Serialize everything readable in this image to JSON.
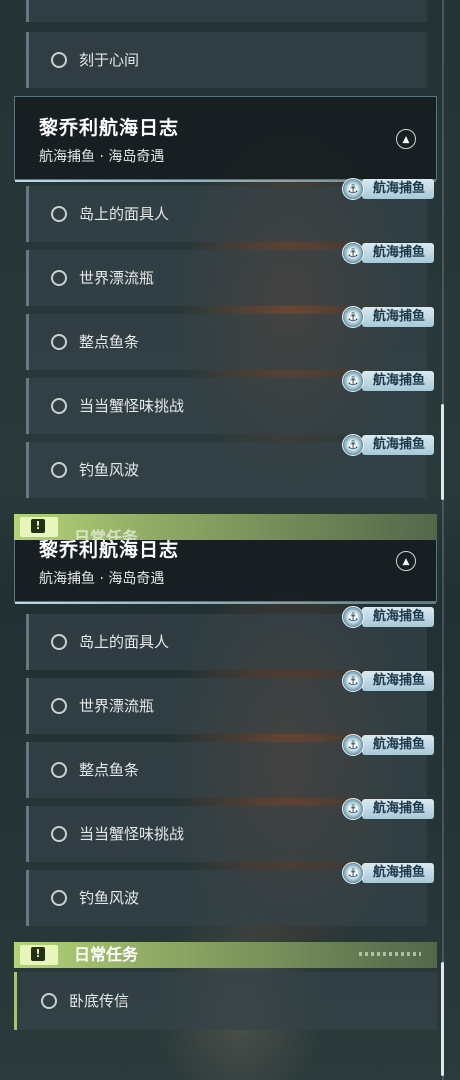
{
  "group": {
    "title": "黎乔利航海日志",
    "subtitle": "航海捕鱼 · 海岛奇遇"
  },
  "previous_item": "刻于心间",
  "tag_label": "航海捕鱼",
  "quests": [
    {
      "label": "岛上的面具人"
    },
    {
      "label": "世界漂流瓶"
    },
    {
      "label": "整点鱼条"
    },
    {
      "label": "当当蟹怪味挑战"
    },
    {
      "label": "钓鱼风波"
    }
  ],
  "daily": {
    "title": "日常任务",
    "items": [
      {
        "label": "卧底传信"
      }
    ]
  },
  "colors": {
    "daily_accent": "#a7c27a",
    "tag_bg": "#c1dbe6"
  },
  "icons": {
    "collapse": "chevron-up-icon",
    "quest_status": "circle-icon",
    "daily": "exclamation-icon",
    "tag": "fishing-icon"
  }
}
